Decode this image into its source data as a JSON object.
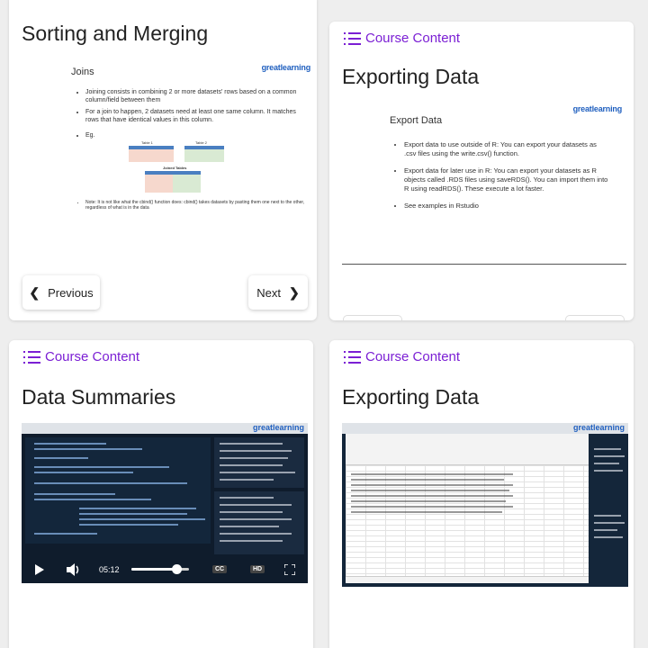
{
  "colors": {
    "accent": "#7b1fd4",
    "brand": "#1f5fbf"
  },
  "cards": [
    {
      "title": "Sorting and Merging",
      "slide": {
        "brand": "greatlearning",
        "heading": "Joins",
        "bullets": [
          "Joining consists in combining 2 or more datasets' rows based on a common column/field between them",
          "For a join to happen, 2 datasets need at least one same column. It matches rows that have identical values in this column.",
          "Eg.",
          "Note: It is not like what the cbind() function does: cbind() takes datasets by pasting them one next to the other, regardless of what is in the data"
        ],
        "table_titles": [
          "Table 1",
          "Table 2",
          "Joined Tables"
        ]
      },
      "prev_label": "Previous",
      "next_label": "Next"
    },
    {
      "course_content": "Course Content",
      "title": "Exporting Data",
      "slide": {
        "brand": "greatlearning",
        "heading": "Export Data",
        "bullets": [
          "Export data to use outside of R: You can export your datasets as .csv files using the write.csv() function.",
          "Export data for later use in R: You can export your datasets as R objects called .RDS files using saveRDS(). You can import them into R using readRDS(). These execute a lot faster.",
          "See examples in Rstudio"
        ]
      }
    },
    {
      "course_content": "Course Content",
      "title": "Data Summaries",
      "video": {
        "time": "05:12",
        "progress": 0.78,
        "brand": "greatlearning",
        "cc_label": "CC",
        "hd_label": "HD"
      }
    },
    {
      "course_content": "Course Content",
      "title": "Exporting Data",
      "video": {
        "brand": "greatlearning"
      }
    }
  ]
}
